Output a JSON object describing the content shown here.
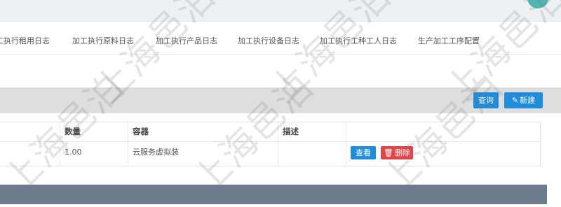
{
  "nav": {
    "tabs": [
      "工执行租用日志",
      "加工执行原料日志",
      "加工执行产品日志",
      "加工执行设备日志",
      "加工执行工种工人日志",
      "生产加工工序配置"
    ]
  },
  "toolbar": {
    "query_label": "查询",
    "new_label": "新建"
  },
  "table": {
    "headers": [
      "",
      "数量",
      "容器",
      "描述",
      ""
    ],
    "rows": [
      {
        "col0": "",
        "quantity": "1.00",
        "container": "云服务虚拟装",
        "description": ""
      }
    ]
  },
  "row_actions": {
    "view_label": "查看",
    "delete_label": "删除"
  },
  "watermark": {
    "text": "上海邑泊"
  },
  "colors": {
    "primary": "#1f8ddc",
    "danger": "#e0454a",
    "footer": "#6c7b8e",
    "toolbar": "#dedede",
    "badge": "#4fb7b0"
  },
  "icons": {
    "new": "pencil-icon",
    "delete": "trash-icon"
  }
}
